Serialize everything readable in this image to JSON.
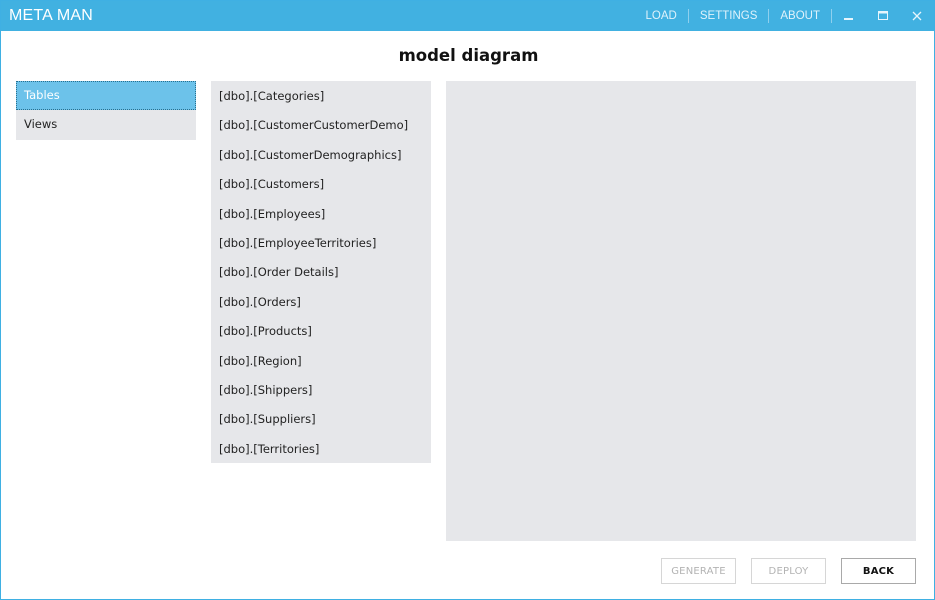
{
  "app": {
    "title": "META MAN"
  },
  "nav": {
    "load": "LOAD",
    "settings": "SETTINGS",
    "about": "ABOUT"
  },
  "window_controls": [
    "minimize-icon",
    "maximize-icon",
    "close-icon"
  ],
  "page": {
    "title": "model diagram"
  },
  "categories": [
    {
      "label": "Tables",
      "selected": true
    },
    {
      "label": "Views",
      "selected": false
    }
  ],
  "tables": [
    "[dbo].[Categories]",
    "[dbo].[CustomerCustomerDemo]",
    "[dbo].[CustomerDemographics]",
    "[dbo].[Customers]",
    "[dbo].[Employees]",
    "[dbo].[EmployeeTerritories]",
    "[dbo].[Order Details]",
    "[dbo].[Orders]",
    "[dbo].[Products]",
    "[dbo].[Region]",
    "[dbo].[Shippers]",
    "[dbo].[Suppliers]",
    "[dbo].[Territories]"
  ],
  "buttons": {
    "generate": "GENERATE",
    "deploy": "DEPLOY",
    "back": "BACK"
  },
  "colors": {
    "accent": "#41b1e1",
    "selected": "#6cc2ea",
    "panel": "#e6e7ea"
  }
}
